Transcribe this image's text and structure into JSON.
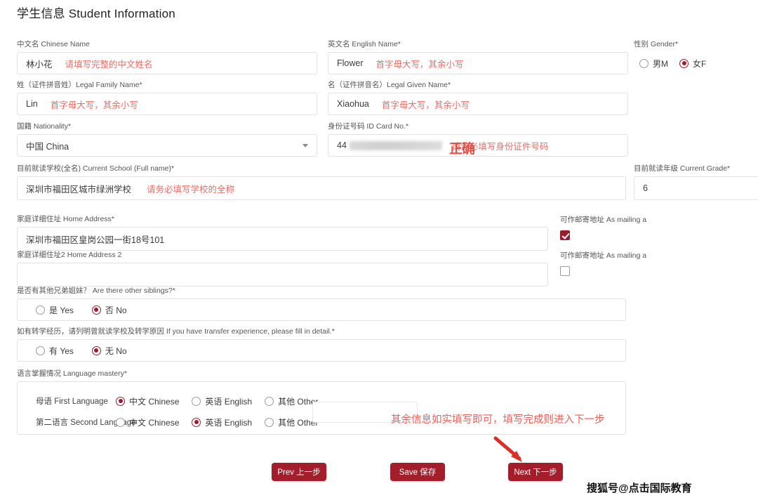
{
  "page": {
    "title": "学生信息 Student Information",
    "watermark": "搜狐号@点击国际教育"
  },
  "fields": {
    "chinese_name": {
      "label": "中文名 Chinese Name",
      "value": "林小花",
      "note": "请填写完整的中文姓名"
    },
    "english_name": {
      "label": "英文名 English Name*",
      "value": "Flower",
      "note": "首字母大写，其余小写"
    },
    "gender": {
      "label": "性别 Gender*",
      "options": [
        "男M",
        "女F"
      ],
      "selected": "女F"
    },
    "legal_family_name": {
      "label": "姓（证件拼音姓）Legal Family Name*",
      "value": "Lin",
      "note": "首字母大写，其余小写"
    },
    "legal_given_name": {
      "label": "名（证件拼音名）Legal Given Name*",
      "value": "Xiaohua",
      "note": "首字母大写，其余小写"
    },
    "nationality": {
      "label": "国籍 Nationality*",
      "value": "中国 China"
    },
    "id_card": {
      "label": "身份证号码 ID Card No.*",
      "value": "44",
      "note": "请务必填写身份证件号码",
      "note_overlay": "正确"
    },
    "current_school": {
      "label": "目前就读学校(全名) Current School (Full name)*",
      "value": "深圳市福田区城市绿洲学校",
      "note": "请务必填写学校的全称"
    },
    "current_grade": {
      "label": "目前就读年级 Current Grade*",
      "value": "6"
    },
    "home_address": {
      "label": "家庭详细住址 Home Address*",
      "value": "深圳市福田区皇岗公园一街18号101"
    },
    "home_address2": {
      "label": "家庭详细住址2 Home Address 2",
      "value": ""
    },
    "mailing1": {
      "label": "可作邮寄地址 As mailing a",
      "checked": true
    },
    "mailing2": {
      "label": "可作邮寄地址 As mailing a",
      "checked": false
    },
    "siblings": {
      "label": "是否有其他兄弟姐妹？ Are there other siblings?*",
      "options": [
        "是 Yes",
        "否 No"
      ],
      "selected": "否 No"
    },
    "transfer": {
      "label": "如有转学经历，请列明曾就读学校及转学原因 If you have transfer experience, please fill in detail.*",
      "options": [
        "有 Yes",
        "无 No"
      ],
      "selected": "无 No"
    },
    "language": {
      "label": "语言掌握情况 Language mastery*",
      "rows": [
        {
          "name": "母语 First Language",
          "options": [
            "中文 Chinese",
            "英语 English",
            "其他 Other"
          ],
          "selected": "中文 Chinese"
        },
        {
          "name": "第二语言 Second Language",
          "options": [
            "中文 Chinese",
            "英语 English",
            "其他 Other"
          ],
          "selected": "英语 English"
        }
      ],
      "other_value": ""
    }
  },
  "annotation": {
    "final_note": "其余信息如实填写即可，填写完成则进入下一步"
  },
  "buttons": {
    "prev": "Prev 上一步",
    "save": "Save 保存",
    "next": "Next 下一步"
  },
  "colors": {
    "annotation_red": "#e8615a",
    "button_red": "#a31d2b",
    "accent": "#9b1b2e"
  }
}
